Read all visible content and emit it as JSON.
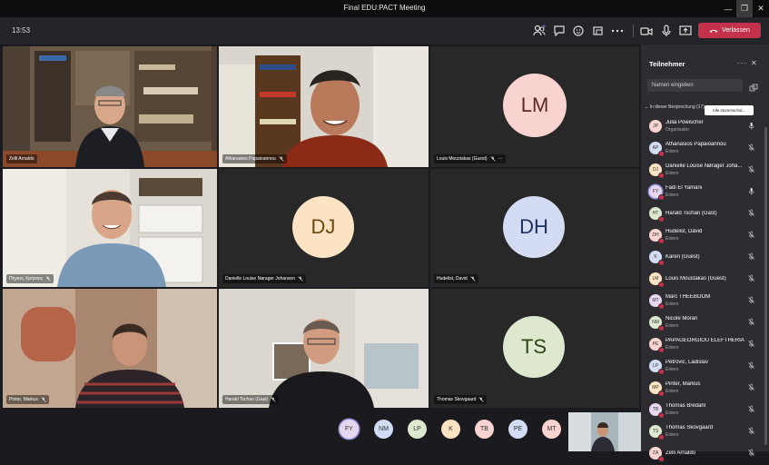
{
  "window": {
    "title": "Final EDU:PACT Meeting"
  },
  "toolbar": {
    "time": "13:53",
    "leave_label": "Verlassen",
    "icons": [
      "people-icon",
      "chat-icon",
      "reactions-icon",
      "rooms-icon",
      "more-icon",
      "camera-icon",
      "mic-icon",
      "share-icon",
      "leave-phone-icon"
    ]
  },
  "tiles": [
    {
      "name": "Zelli Arnaldo",
      "mic": false
    },
    {
      "name": "Athanasios Papaioannou",
      "mic": true
    },
    {
      "name": "Louis Moustakas (Guest)",
      "mic": true,
      "initials": "LM",
      "more": "···"
    },
    {
      "name": "Πηγκος Χρήστος",
      "mic": true
    },
    {
      "name": "Danielle Louise Nørager Johansen",
      "mic": true,
      "initials": "DJ"
    },
    {
      "name": "Hudelist, David",
      "mic": true,
      "initials": "DH"
    },
    {
      "name": "Pinter, Markus",
      "mic": true
    },
    {
      "name": "Harald Tschan (Gast)",
      "mic": true
    },
    {
      "name": "Thomas Skovgaard",
      "mic": true,
      "initials": "TS"
    }
  ],
  "bottom_avatars": [
    "FY",
    "NM",
    "LP",
    "K",
    "TB",
    "PE",
    "MT"
  ],
  "panel": {
    "title": "Teilnehmer",
    "menu": "···",
    "close": "✕",
    "search_placeholder": "Namen eingeben",
    "section_label": "In dieser Besprechung (17)",
    "mute_all": "Alle stummschal...",
    "participants": [
      {
        "initials": "JP",
        "name": "Julia Powischer",
        "role": "Organisator",
        "mic": "on"
      },
      {
        "initials": "AP",
        "name": "Athanasios Papaioannou",
        "role": "Extern",
        "mic": "off"
      },
      {
        "initials": "DJ",
        "name": "Danielle Louise Nørager Joha...",
        "role": "Extern",
        "mic": "off"
      },
      {
        "initials": "FY",
        "name": "Fadi El Yamani",
        "role": "Extern",
        "mic": "on"
      },
      {
        "initials": "HT",
        "name": "Harald Tschan (Gast)",
        "role": "",
        "mic": "off"
      },
      {
        "initials": "DH",
        "name": "Hudelist, David",
        "role": "Extern",
        "mic": "off"
      },
      {
        "initials": "K",
        "name": "Karen (Guest)",
        "role": "",
        "mic": "off"
      },
      {
        "initials": "LM",
        "name": "Louis Moustakas (Guest)",
        "role": "",
        "mic": "off"
      },
      {
        "initials": "MT",
        "name": "Marc THEEBOOM",
        "role": "Extern",
        "mic": "off"
      },
      {
        "initials": "NM",
        "name": "Nicole Moran",
        "role": "Extern",
        "mic": "off"
      },
      {
        "initials": "PE",
        "name": "PAPAGEORGIOU ELEFTHERIA",
        "role": "Extern",
        "mic": "off"
      },
      {
        "initials": "LP",
        "name": "Petrovic, Ladislav",
        "role": "Extern",
        "mic": "off"
      },
      {
        "initials": "MP",
        "name": "Pinter, Markus",
        "role": "Extern",
        "mic": "off"
      },
      {
        "initials": "TB",
        "name": "Thomas Bredahl",
        "role": "Extern",
        "mic": "off"
      },
      {
        "initials": "TS",
        "name": "Thomas Skovgaard",
        "role": "Extern",
        "mic": "off"
      },
      {
        "initials": "ZA",
        "name": "Zelli Arnaldo",
        "role": "",
        "mic": "off"
      }
    ]
  },
  "colors": {
    "accent": "#6264a7",
    "leave": "#c4314b",
    "avatar_pink": "#f9d3d0",
    "avatar_peach": "#fbe3c4",
    "avatar_blue": "#d3dcf3",
    "avatar_green": "#dde8cf",
    "avatar_purple": "#e6d7ef"
  }
}
